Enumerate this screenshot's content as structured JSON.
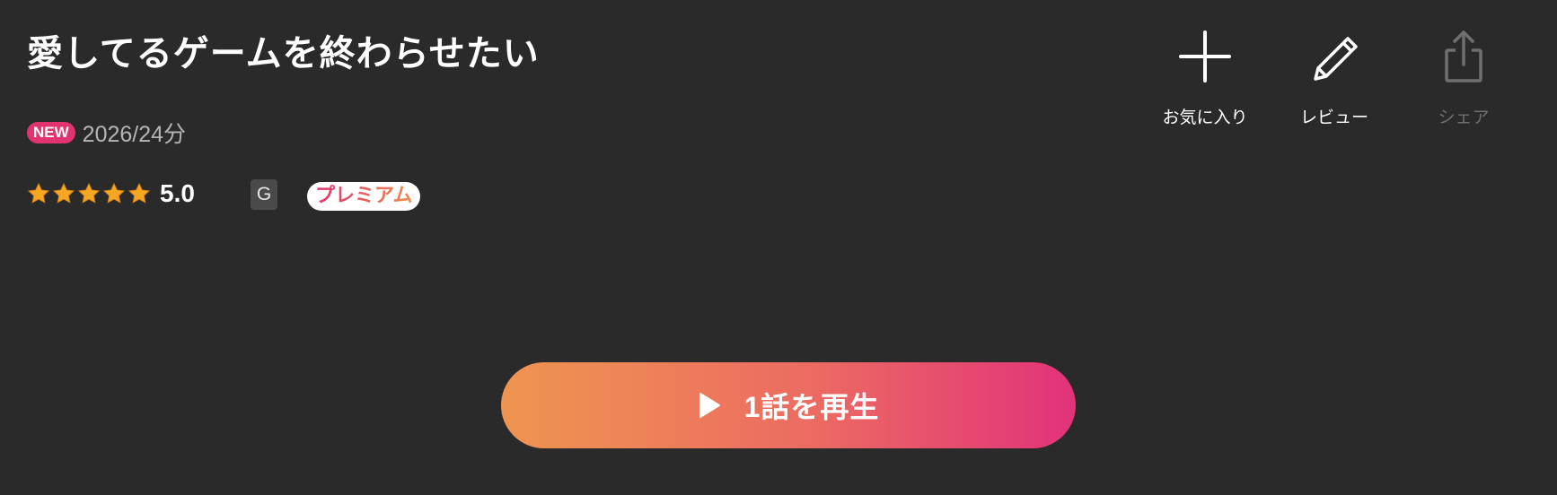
{
  "title": "愛してるゲームを終わらせたい",
  "meta": {
    "new_badge": "NEW",
    "year_duration": "2026/24分"
  },
  "rating": {
    "stars": 5,
    "max_stars": 5,
    "value": "5.0"
  },
  "badges": {
    "age_rating": "G",
    "premium": "プレミアム"
  },
  "actions": [
    {
      "label": "お気に入り",
      "icon": "plus-icon",
      "enabled": true
    },
    {
      "label": "レビュー",
      "icon": "pencil-icon",
      "enabled": true
    },
    {
      "label": "シェア",
      "icon": "share-icon",
      "enabled": false
    }
  ],
  "play_button": {
    "label": "1話を再生",
    "icon": "play-icon"
  },
  "colors": {
    "background": "#2a2a2a",
    "accent_pink": "#e0336f",
    "accent_orange": "#ef9550",
    "star": "#f5a623",
    "disabled": "#6f6f6f"
  }
}
